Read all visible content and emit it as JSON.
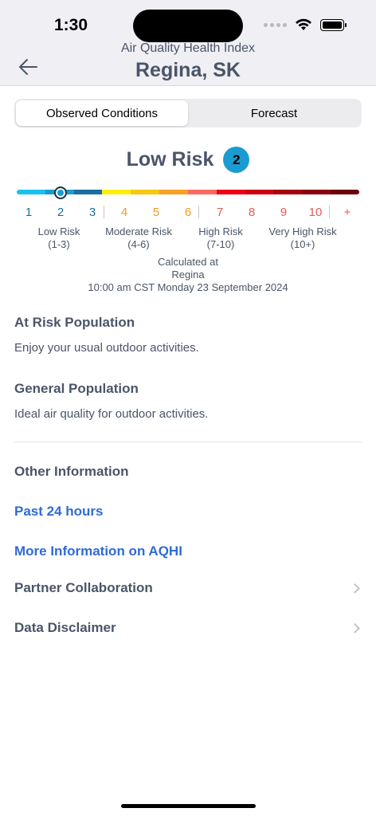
{
  "status_bar": {
    "time": "1:30"
  },
  "nav": {
    "subtitle": "Air Quality Health Index",
    "title": "Regina, SK"
  },
  "tabs": [
    {
      "label": "Observed Conditions",
      "active": true
    },
    {
      "label": "Forecast",
      "active": false
    }
  ],
  "risk": {
    "label": "Low Risk",
    "value": "2",
    "badge_color": "#1a9bd1"
  },
  "scale": {
    "current_value": 2,
    "segment_colors": [
      "#18c1ee",
      "#1a9bd1",
      "#1a6ea0",
      "#fdee0e",
      "#f7c711",
      "#f7a128",
      "#fb6b63",
      "#ef0013",
      "#cc0012",
      "#a70110",
      "#8a000f",
      "#6a0006"
    ],
    "numbers": [
      {
        "text": "1",
        "color": "#1a6ea0"
      },
      {
        "text": "2",
        "color": "#1a6ea0"
      },
      {
        "text": "3",
        "color": "#1a6ea0"
      },
      {
        "text": "4",
        "color": "#f39a1b"
      },
      {
        "text": "5",
        "color": "#f39a1b"
      },
      {
        "text": "6",
        "color": "#f39a1b"
      },
      {
        "text": "7",
        "color": "#ea5b57"
      },
      {
        "text": "8",
        "color": "#ea5b57"
      },
      {
        "text": "9",
        "color": "#ea5b57"
      },
      {
        "text": "10",
        "color": "#ea5b57"
      },
      {
        "text": "+",
        "color": "#ea5b57"
      }
    ],
    "bands": [
      {
        "name": "Low Risk",
        "range": "(1-3)"
      },
      {
        "name": "Moderate Risk",
        "range": "(4-6)"
      },
      {
        "name": "High Risk",
        "range": "(7-10)"
      },
      {
        "name": "Very High Risk",
        "range": "(10+)"
      }
    ]
  },
  "calculated": {
    "label": "Calculated at",
    "location": "Regina",
    "timestamp": "10:00 am CST Monday 23 September 2024"
  },
  "at_risk": {
    "heading": "At Risk Population",
    "text": "Enjoy your usual outdoor activities."
  },
  "general": {
    "heading": "General Population",
    "text": "Ideal air quality for outdoor activities."
  },
  "other": {
    "heading": "Other Information",
    "links": [
      "Past 24 hours",
      "More Information on AQHI"
    ],
    "rows": [
      "Partner Collaboration",
      "Data Disclaimer"
    ]
  }
}
